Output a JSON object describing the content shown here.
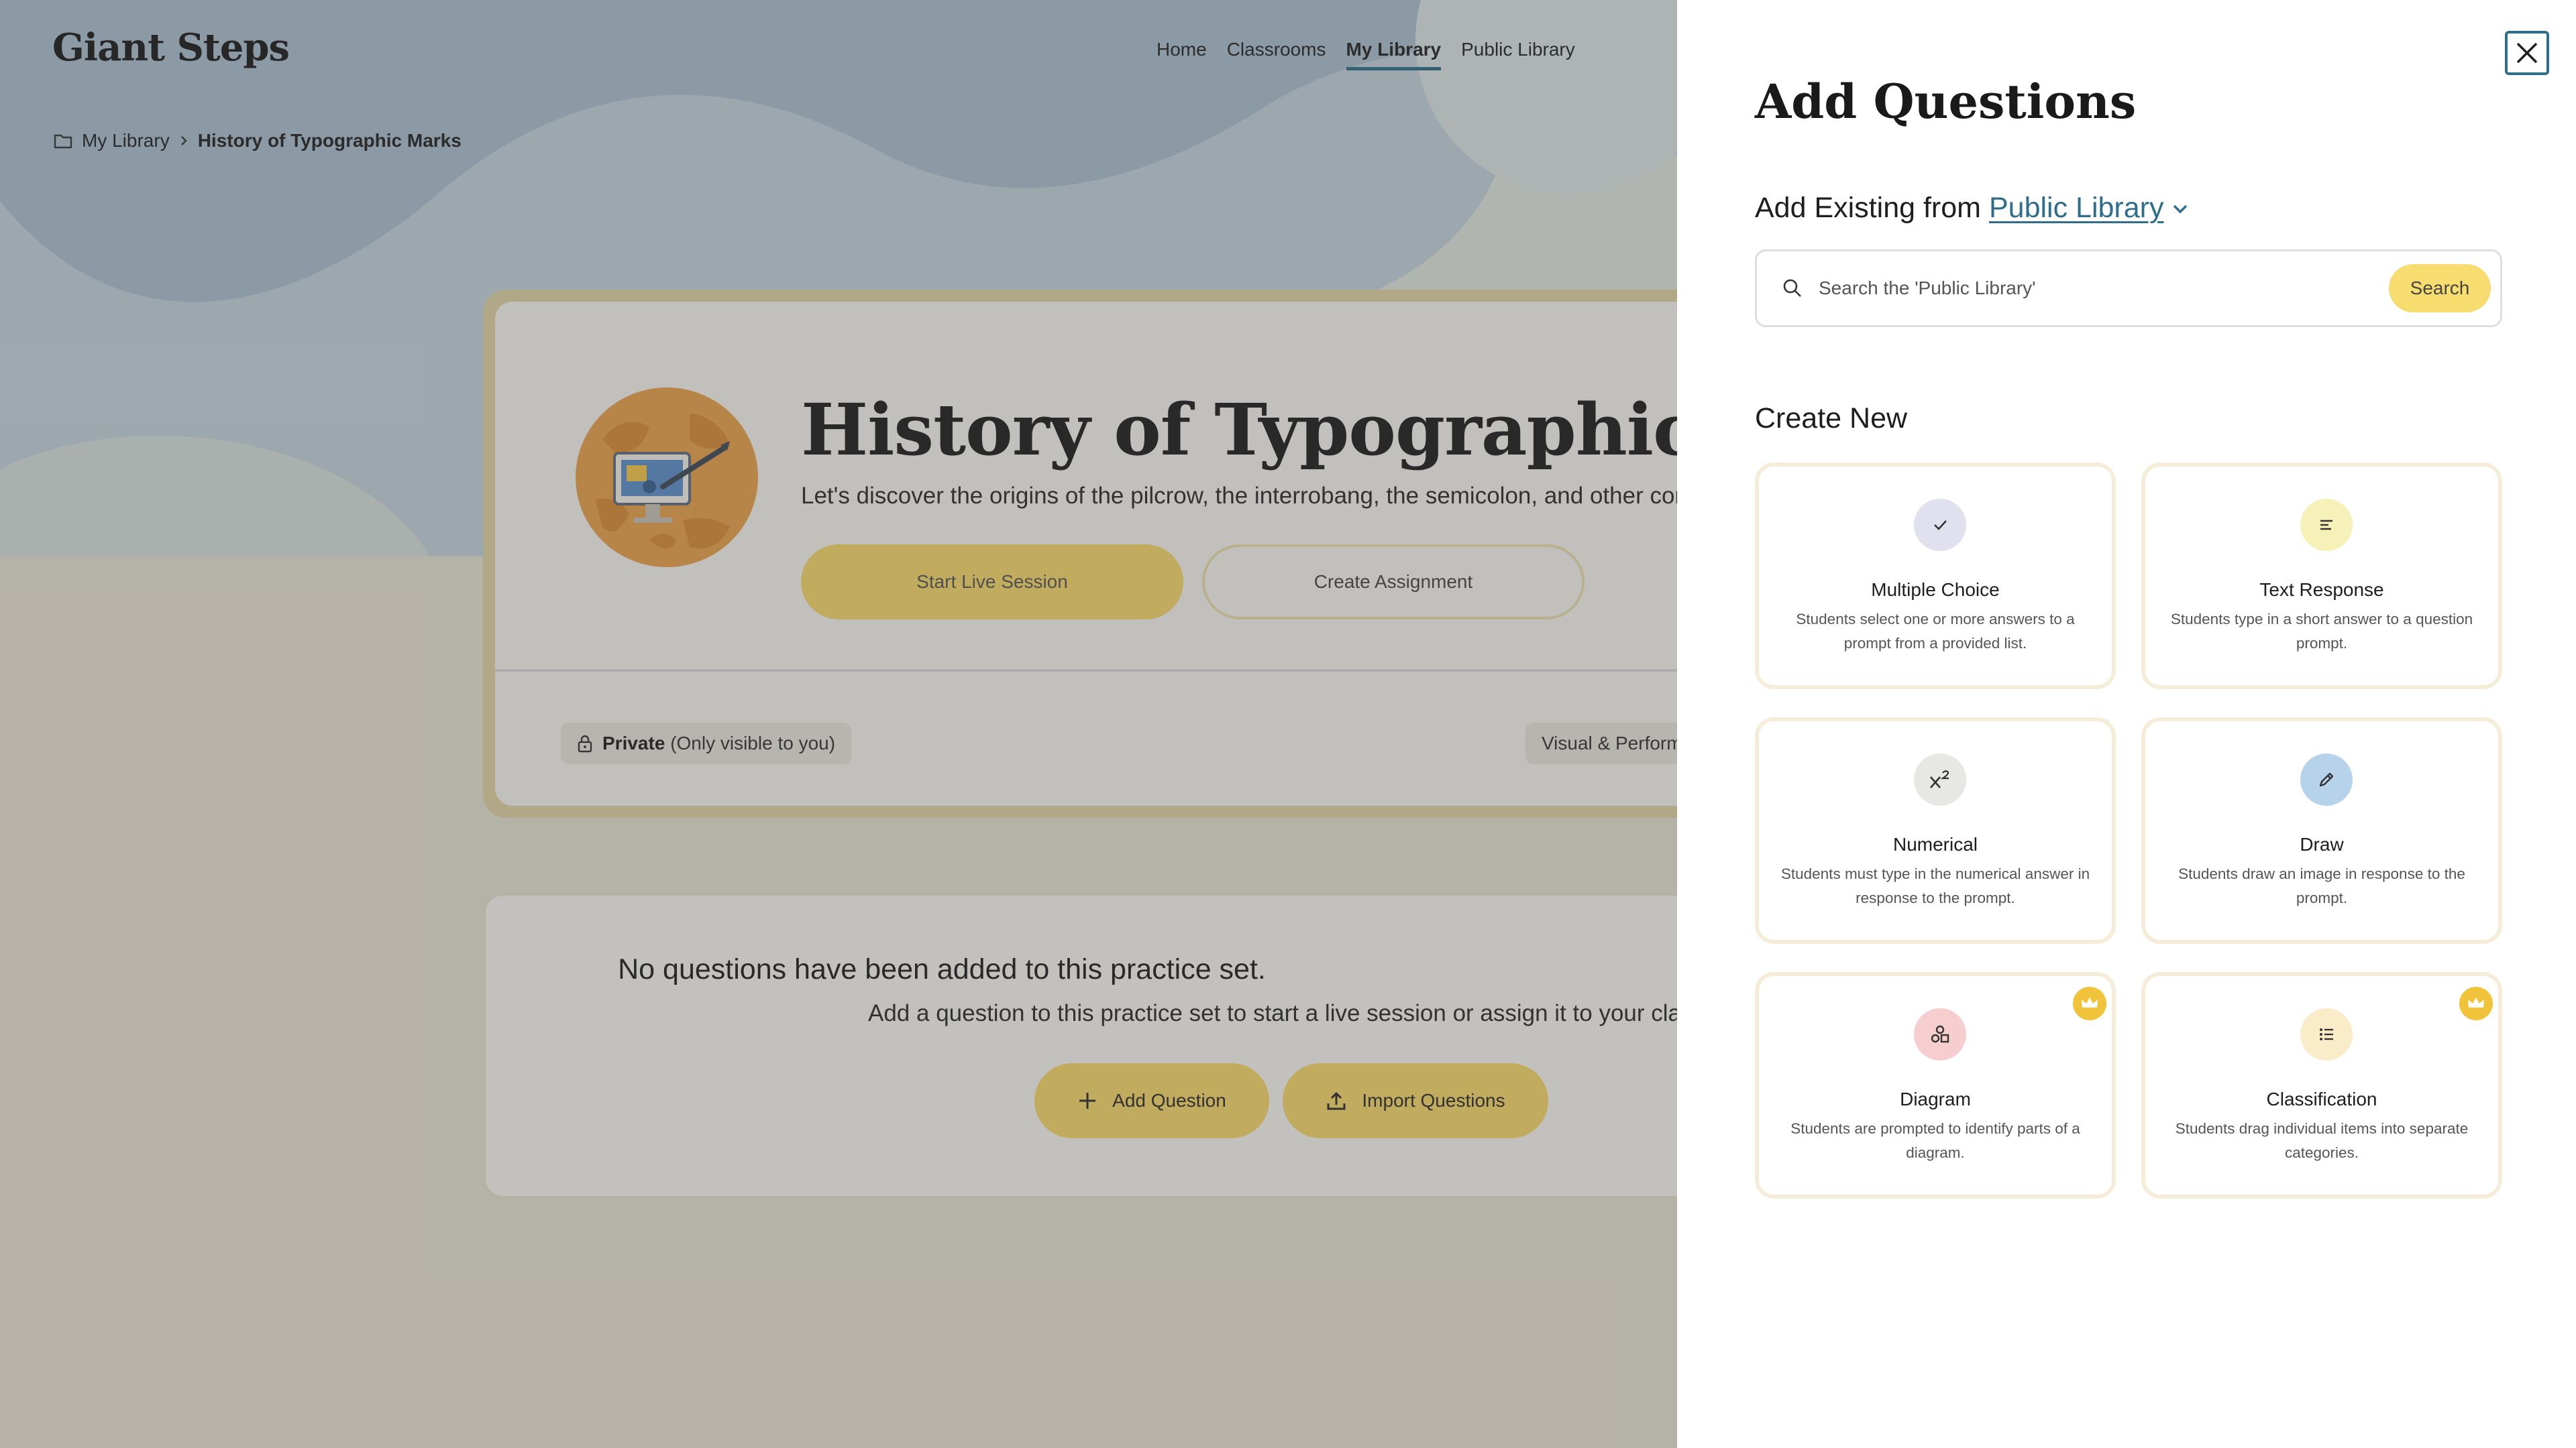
{
  "app": {
    "logo": "Giant Steps"
  },
  "nav": {
    "items": [
      {
        "label": "Home",
        "active": false
      },
      {
        "label": "Classrooms",
        "active": false
      },
      {
        "label": "My Library",
        "active": true
      },
      {
        "label": "Public Library",
        "active": false
      }
    ]
  },
  "breadcrumb": {
    "root": "My Library",
    "current": "History of Typographic Marks"
  },
  "practice_set": {
    "title": "History of Typographic Marks",
    "description": "Let's discover the origins of the pilcrow, the interrobang, the semicolon, and other common marks.",
    "start_live_label": "Start Live Session",
    "create_assignment_label": "Create Assignment",
    "privacy_label": "Private",
    "privacy_note": "(Only visible to you)",
    "subject_tag": "Visual & Performing Arts"
  },
  "empty_state": {
    "title": "No questions have been added to this practice set.",
    "subtitle": "Add a question to this practice set to start a live session or assign it to your class.",
    "add_question_label": "Add Question",
    "import_label": "Import Questions"
  },
  "panel": {
    "title": "Add Questions",
    "existing_prefix": "Add Existing from",
    "library_link": "Public Library",
    "search_placeholder": "Search the 'Public Library'",
    "search_button": "Search",
    "create_title": "Create New",
    "types": [
      {
        "name": "Multiple Choice",
        "desc": "Students select one or more answers to a prompt from a provided list.",
        "icon": "check-icon",
        "color": "#e1e0ee",
        "premium": false
      },
      {
        "name": "Text Response",
        "desc": "Students type in a short answer to a question prompt.",
        "icon": "text-lines-icon",
        "color": "#f5f1b9",
        "premium": false
      },
      {
        "name": "Numerical",
        "desc": "Students must type in the numerical answer in response to the prompt.",
        "icon": "superscript-icon",
        "color": "#e7e8e3",
        "premium": false
      },
      {
        "name": "Draw",
        "desc": "Students draw an image in response to the prompt.",
        "icon": "pencil-icon",
        "color": "#b7d3ec",
        "premium": false
      },
      {
        "name": "Diagram",
        "desc": "Students are prompted to identify parts of a diagram.",
        "icon": "shapes-icon",
        "color": "#f7ced0",
        "premium": true
      },
      {
        "name": "Classification",
        "desc": "Students drag individual items into separate categories.",
        "icon": "list-icon",
        "color": "#faecc8",
        "premium": true
      }
    ]
  },
  "colors": {
    "accent": "#2f6e8a",
    "yellow": "#f5d769",
    "crown": "#f0c33a",
    "bg_blue": "#a9bfce",
    "bg_beige": "#e6e1d2"
  }
}
